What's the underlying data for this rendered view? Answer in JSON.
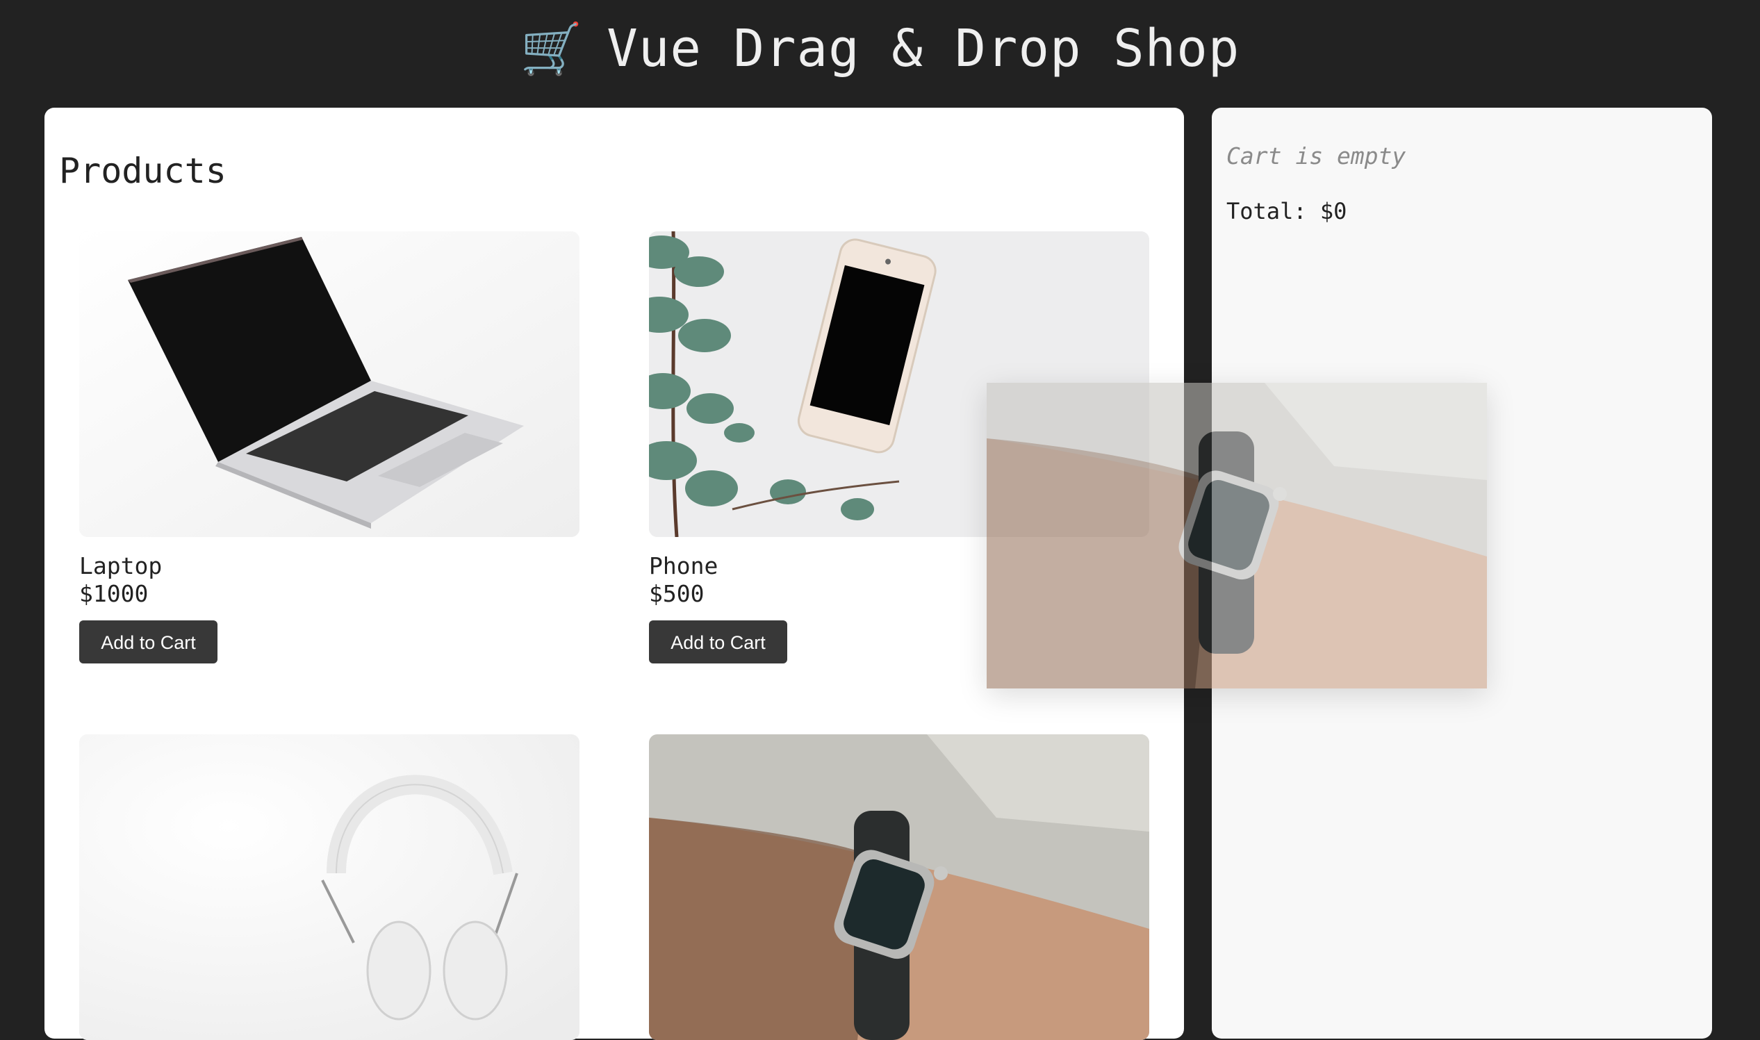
{
  "header": {
    "cart_icon": "🛒",
    "title": "Vue Drag & Drop Shop"
  },
  "products": {
    "title": "Products",
    "items": [
      {
        "name": "Laptop",
        "price": "$1000",
        "button": "Add to Cart",
        "image": "laptop-image"
      },
      {
        "name": "Phone",
        "price": "$500",
        "button": "Add to Cart",
        "image": "phone-image"
      },
      {
        "name": "",
        "price": "",
        "button": "",
        "image": "headphones-image"
      },
      {
        "name": "",
        "price": "",
        "button": "",
        "image": "smartwatch-image"
      }
    ]
  },
  "cart": {
    "empty_text": "Cart is empty",
    "total_label": "Total: $0"
  },
  "drag": {
    "dragged_item_image": "smartwatch-image"
  },
  "colors": {
    "background": "#222222",
    "panel": "#ffffff",
    "cart_panel": "#f8f8f8",
    "button": "#383838",
    "button_text": "#ffffff"
  }
}
